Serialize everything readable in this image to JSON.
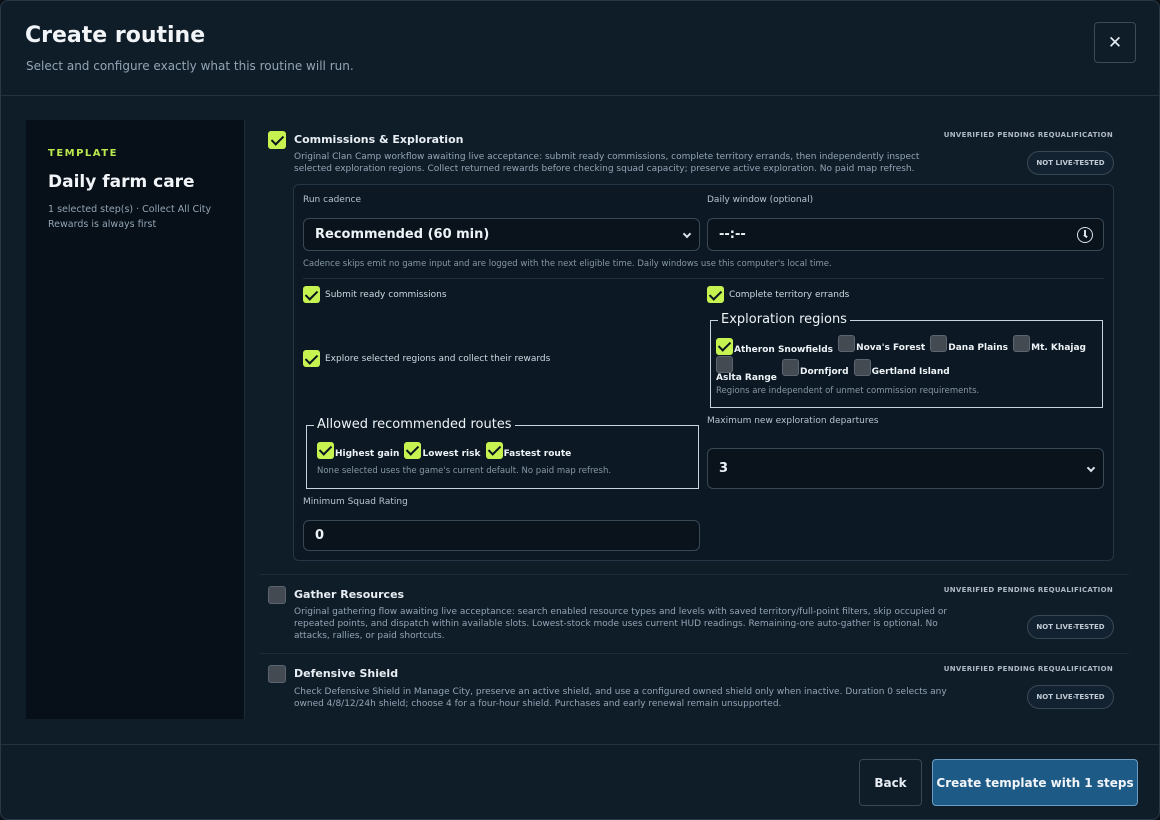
{
  "dialog": {
    "title": "Create routine",
    "subtitle": "Select and configure exactly what this routine will run.",
    "close_glyph": "✕"
  },
  "sidebar": {
    "eyebrow": "TEMPLATE",
    "template_name": "Daily farm care",
    "note": "1 selected step(s) · Collect All City Rewards is always first"
  },
  "steps": [
    {
      "title": "Commissions & Exploration",
      "checked": true,
      "status": "UNVERIFIED PENDING REQUALIFICATION",
      "badge": "NOT LIVE-TESTED",
      "description": "Original Clan Camp workflow awaiting live acceptance: submit ready commissions, complete territory errands, then independently inspect selected exploration regions. Collect returned rewards before checking squad capacity; preserve active exploration. No paid map refresh."
    },
    {
      "title": "Gather Resources",
      "checked": false,
      "status": "UNVERIFIED PENDING REQUALIFICATION",
      "badge": "NOT LIVE-TESTED",
      "description": "Original gathering flow awaiting live acceptance: search enabled resource types and levels with saved territory/full-point filters, skip occupied or repeated points, and dispatch within available slots. Lowest-stock mode uses current HUD readings. Remaining-ore auto-gather is optional. No attacks, rallies, or paid shortcuts."
    },
    {
      "title": "Defensive Shield",
      "checked": false,
      "status": "UNVERIFIED PENDING REQUALIFICATION",
      "badge": "NOT LIVE-TESTED",
      "description": "Check Defensive Shield in Manage City, preserve an active shield, and use a configured owned shield only when inactive. Duration 0 selects any owned 4/8/12/24h shield; choose 4 for a four-hour shield. Purchases and early renewal remain unsupported."
    }
  ],
  "config": {
    "cadence_label": "Run cadence",
    "cadence_value": "Recommended (60 min)",
    "window_label": "Daily window (optional)",
    "window_value": "--:--",
    "cadence_hint": "Cadence skips emit no game input and are logged with the next eligible time. Daily windows use this computer's local time.",
    "submit_commissions": {
      "label": "Submit ready commissions",
      "checked": true
    },
    "complete_errands": {
      "label": "Complete territory errands",
      "checked": true
    },
    "explore_regions": {
      "label": "Explore selected regions and collect their rewards",
      "checked": true
    },
    "regions": {
      "legend": "Exploration regions",
      "items": [
        {
          "label": "Atheron Snowfields",
          "checked": true
        },
        {
          "label": "Nova's Forest",
          "checked": false
        },
        {
          "label": "Dana Plains",
          "checked": false
        },
        {
          "label": "Mt. Khajag",
          "checked": false
        },
        {
          "label": "Aslta Range",
          "checked": false
        },
        {
          "label": "Dornfjord",
          "checked": false
        },
        {
          "label": "Gertland Island",
          "checked": false
        }
      ],
      "hint": "Regions are independent of unmet commission requirements."
    },
    "routes": {
      "legend": "Allowed recommended routes",
      "items": [
        {
          "label": "Highest gain",
          "checked": true
        },
        {
          "label": "Lowest risk",
          "checked": true
        },
        {
          "label": "Fastest route",
          "checked": true
        }
      ],
      "hint": "None selected uses the game's current default. No paid map refresh."
    },
    "max_departures_label": "Maximum new exploration departures",
    "max_departures_value": "3",
    "min_rating_label": "Minimum Squad Rating",
    "min_rating_value": "0"
  },
  "footer": {
    "back_label": "Back",
    "create_label": "Create template with 1 steps"
  },
  "colors": {
    "accent_check": "#c6f34f",
    "primary_button": "#1e5a86",
    "background": "#0f1d29"
  }
}
